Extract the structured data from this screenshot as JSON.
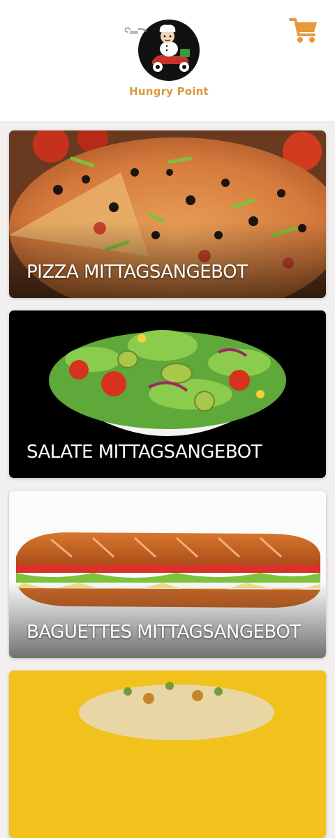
{
  "header": {
    "brand_name": "Hungry Point",
    "logo_icon": "chef-scooter-logo",
    "cart_icon": "shopping-cart-icon",
    "accent_color": "#e69a3a"
  },
  "categories": [
    {
      "title": "PIZZA MITTAGSANGEBOT",
      "image": "pizza-image"
    },
    {
      "title": "SALATE MITTAGSANGEBOT",
      "image": "salad-image"
    },
    {
      "title": "BAGUETTES MITTAGSANGEBOT",
      "image": "baguette-image"
    },
    {
      "title": "",
      "image": "gratin-image"
    }
  ]
}
